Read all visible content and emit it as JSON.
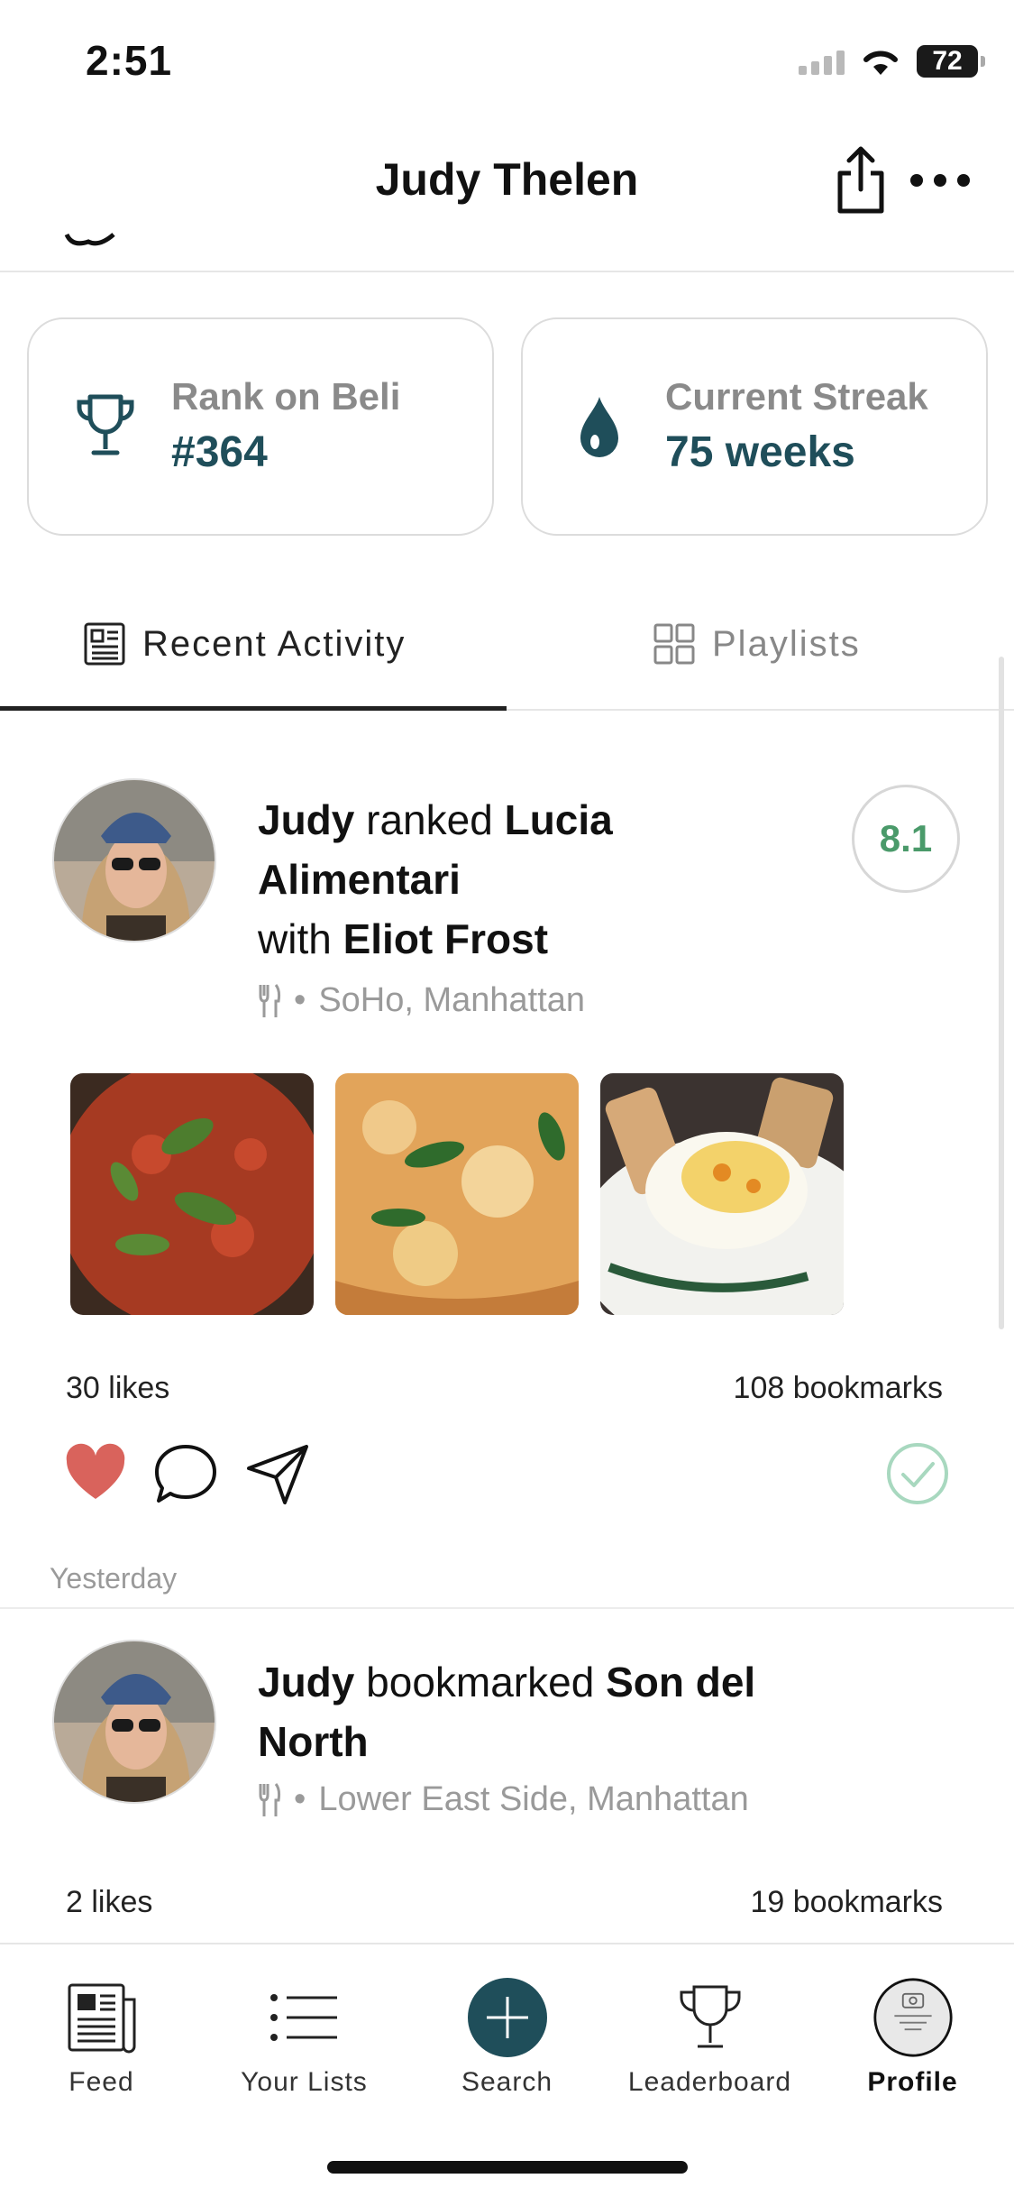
{
  "status_bar": {
    "time": "2:51",
    "battery": "72"
  },
  "header": {
    "title": "Judy Thelen"
  },
  "stats": {
    "rank": {
      "label": "Rank on Beli",
      "value": "#364"
    },
    "streak": {
      "label": "Current Streak",
      "value": "75 weeks"
    }
  },
  "tabs": {
    "recent": "Recent Activity",
    "playlists": "Playlists",
    "active": "Recent Activity"
  },
  "activities": [
    {
      "user": "Judy",
      "verb": "ranked",
      "place": "Lucia Alimentari",
      "with_prefix": "with",
      "with_name": "Eliot Frost",
      "location": "SoHo, Manhattan",
      "score": "8.1",
      "likes": "30 likes",
      "bookmarks": "108 bookmarks",
      "liked": true
    },
    {
      "user": "Judy",
      "verb": "bookmarked",
      "place": "Son del North",
      "location": "Lower East Side, Manhattan",
      "likes": "2 likes",
      "bookmarks": "19 bookmarks"
    }
  ],
  "date_divider": "Yesterday",
  "nav": {
    "feed": "Feed",
    "lists": "Your Lists",
    "search": "Search",
    "leaderboard": "Leaderboard",
    "profile": "Profile",
    "active": "Profile"
  },
  "colors": {
    "accent": "#1f4e5a",
    "score_green": "#4a9a6a",
    "heart": "#d9635c",
    "check": "#a8d8bf"
  }
}
